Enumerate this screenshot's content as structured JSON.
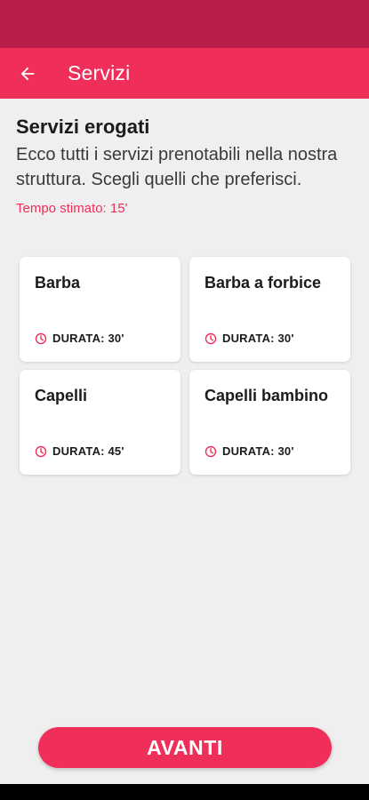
{
  "header": {
    "title": "Servizi",
    "back_icon": "arrow-left-icon"
  },
  "section": {
    "title": "Servizi erogati",
    "description": "Ecco tutti i servizi prenotabili nella nostra struttura. Scegli quelli che preferisci.",
    "estimate": "Tempo stimato: 15'"
  },
  "services": [
    {
      "name": "Barba",
      "duration": "DURATA: 30'"
    },
    {
      "name": "Barba a forbice",
      "duration": "DURATA: 30'"
    },
    {
      "name": "Capelli",
      "duration": "DURATA: 45'"
    },
    {
      "name": "Capelli bambino",
      "duration": "DURATA: 30'"
    }
  ],
  "actions": {
    "next_label": "AVANTI"
  },
  "colors": {
    "primary": "#ef2f5a",
    "status_bar": "#b81c48",
    "background": "#efefef"
  }
}
